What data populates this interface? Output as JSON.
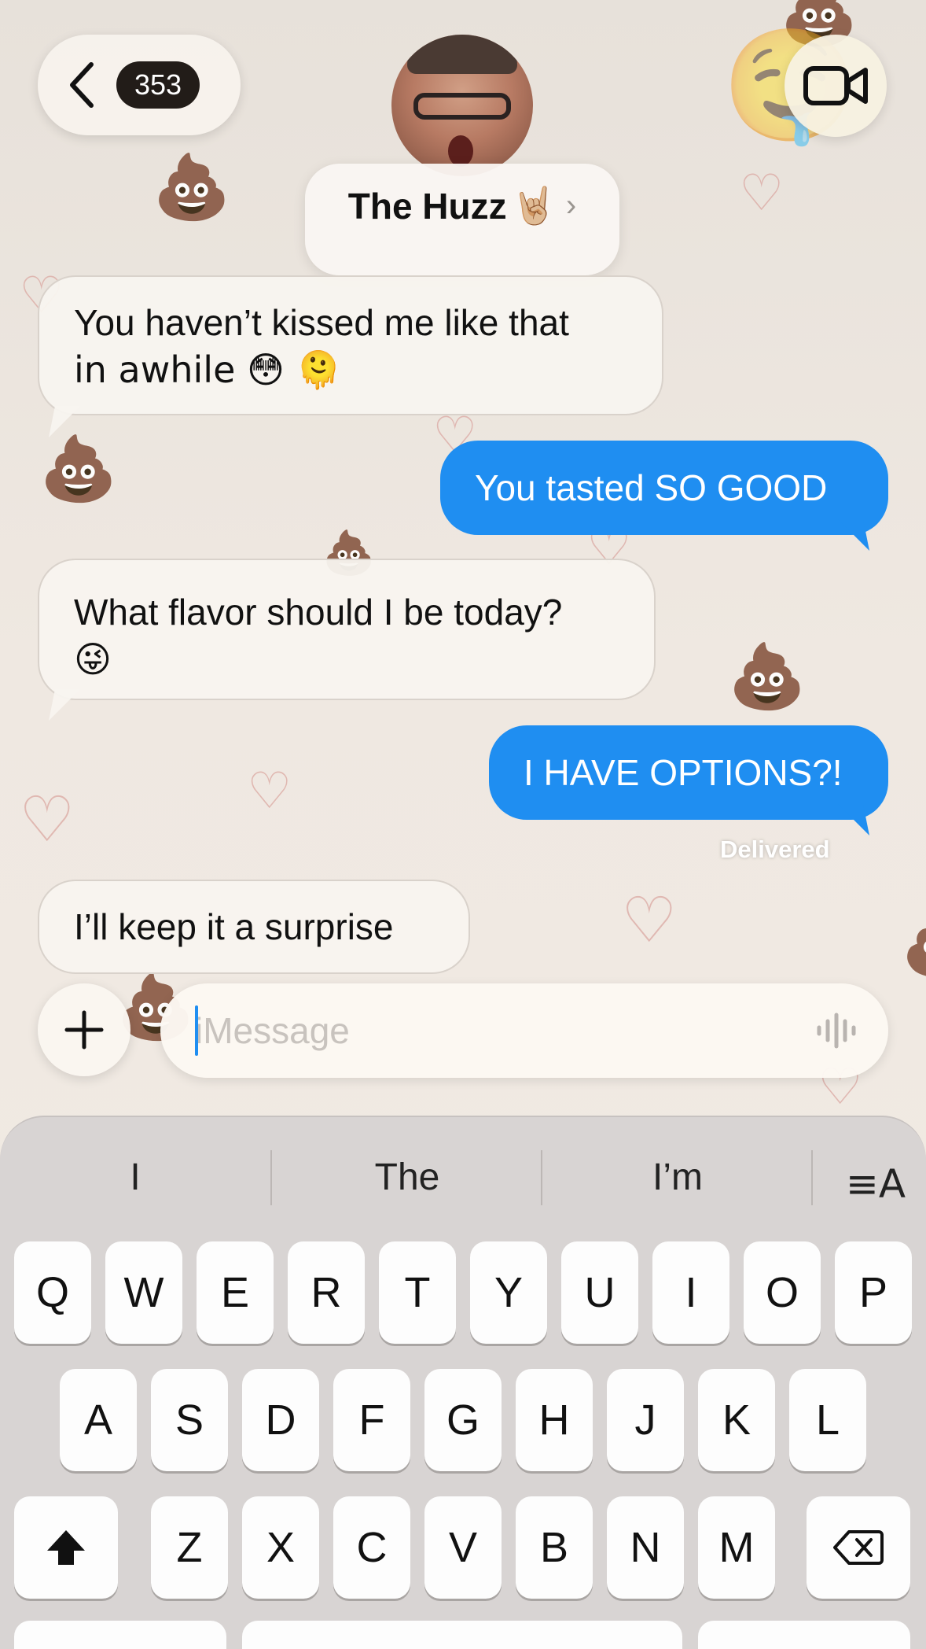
{
  "header": {
    "back_count": "353",
    "contact_name": "The Huzz",
    "contact_emoji": "🤘🏼"
  },
  "messages": [
    {
      "direction": "incoming",
      "lines": [
        "You haven’t kissed me like that",
        "in awhile 😳 🫠"
      ]
    },
    {
      "direction": "outgoing",
      "lines": [
        "You tasted SO GOOD"
      ]
    },
    {
      "direction": "incoming",
      "lines": [
        "What flavor should I be today?",
        "😜"
      ]
    },
    {
      "direction": "outgoing",
      "lines": [
        "I HAVE OPTIONS?!"
      ]
    },
    {
      "direction": "incoming",
      "lines": [
        "I’ll keep it a surprise"
      ]
    }
  ],
  "status": {
    "delivered": "Delivered"
  },
  "input": {
    "placeholder": "iMessage",
    "value": ""
  },
  "keyboard": {
    "suggestions": [
      "I",
      "The",
      "I’m"
    ],
    "row1": [
      "Q",
      "W",
      "E",
      "R",
      "T",
      "Y",
      "U",
      "I",
      "O",
      "P"
    ],
    "row2": [
      "A",
      "S",
      "D",
      "F",
      "G",
      "H",
      "J",
      "K",
      "L"
    ],
    "row3": [
      "Z",
      "X",
      "C",
      "V",
      "B",
      "N",
      "M"
    ]
  },
  "icons": {
    "back": "chevron-left-icon",
    "video": "video-camera-icon",
    "plus": "plus-icon",
    "dictation": "waveform-icon",
    "format": "text-format-icon",
    "shift": "shift-arrow-icon",
    "delete": "backspace-icon"
  },
  "colors": {
    "outgoing_bubble": "#1f8ef1",
    "incoming_bubble": "#f8f4ef",
    "badge": "#221c18",
    "keyboard_bg": "#d8d4d3"
  }
}
